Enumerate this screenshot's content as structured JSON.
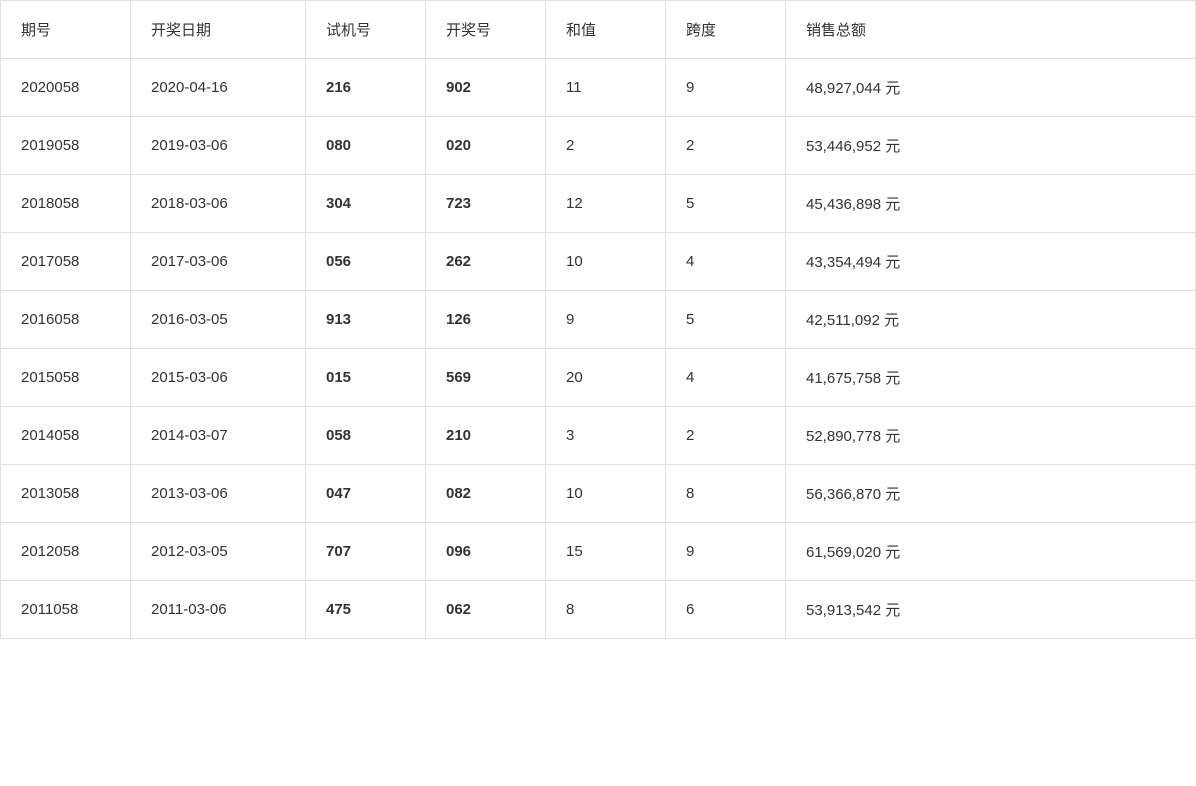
{
  "table": {
    "headers": [
      "期号",
      "开奖日期",
      "试机号",
      "开奖号",
      "和值",
      "跨度",
      "销售总额"
    ],
    "rows": [
      {
        "qihao": "2020058",
        "date": "2020-04-16",
        "shiji": "216",
        "kaijang": "902",
        "hezhi": "11",
        "kuadu": "9",
        "xiaoshou": "48,927,044 元"
      },
      {
        "qihao": "2019058",
        "date": "2019-03-06",
        "shiji": "080",
        "kaijang": "020",
        "hezhi": "2",
        "kuadu": "2",
        "xiaoshou": "53,446,952 元"
      },
      {
        "qihao": "2018058",
        "date": "2018-03-06",
        "shiji": "304",
        "kaijang": "723",
        "hezhi": "12",
        "kuadu": "5",
        "xiaoshou": "45,436,898 元"
      },
      {
        "qihao": "2017058",
        "date": "2017-03-06",
        "shiji": "056",
        "kaijang": "262",
        "hezhi": "10",
        "kuadu": "4",
        "xiaoshou": "43,354,494 元"
      },
      {
        "qihao": "2016058",
        "date": "2016-03-05",
        "shiji": "913",
        "kaijang": "126",
        "hezhi": "9",
        "kuadu": "5",
        "xiaoshou": "42,511,092 元"
      },
      {
        "qihao": "2015058",
        "date": "2015-03-06",
        "shiji": "015",
        "kaijang": "569",
        "hezhi": "20",
        "kuadu": "4",
        "xiaoshou": "41,675,758 元"
      },
      {
        "qihao": "2014058",
        "date": "2014-03-07",
        "shiji": "058",
        "kaijang": "210",
        "hezhi": "3",
        "kuadu": "2",
        "xiaoshou": "52,890,778 元"
      },
      {
        "qihao": "2013058",
        "date": "2013-03-06",
        "shiji": "047",
        "kaijang": "082",
        "hezhi": "10",
        "kuadu": "8",
        "xiaoshou": "56,366,870 元"
      },
      {
        "qihao": "2012058",
        "date": "2012-03-05",
        "shiji": "707",
        "kaijang": "096",
        "hezhi": "15",
        "kuadu": "9",
        "xiaoshou": "61,569,020 元"
      },
      {
        "qihao": "2011058",
        "date": "2011-03-06",
        "shiji": "475",
        "kaijang": "062",
        "hezhi": "8",
        "kuadu": "6",
        "xiaoshou": "53,913,542 元"
      }
    ]
  }
}
